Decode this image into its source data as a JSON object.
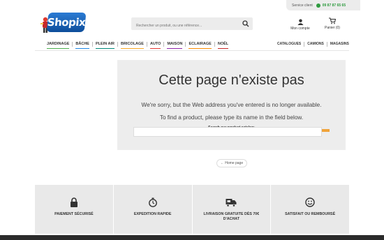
{
  "topbar": {
    "service_label": "Service client",
    "phone": "09 87 87 65 65"
  },
  "brand": {
    "logo_text": "Shopix",
    "primary_color": "#1a5fb4",
    "accent_color": "#f0a33a"
  },
  "search": {
    "placeholder": "Rechercher un produit, ou une référence..."
  },
  "account": {
    "label": "Mon compte"
  },
  "cart": {
    "label": "Panier (0)"
  },
  "nav": {
    "items": [
      {
        "label": "JARDINAGE",
        "color": "#4caf50"
      },
      {
        "label": "BÂCHE",
        "color": "#1e88e5"
      },
      {
        "label": "PLEIN AIR",
        "color": "#00897b"
      },
      {
        "label": "BRICOLAGE",
        "color": "#f9a825"
      },
      {
        "label": "AUTO",
        "color": "#e53935"
      },
      {
        "label": "MAISON",
        "color": "#8e24aa"
      },
      {
        "label": "ECLAIRAGE",
        "color": "#fb8c00"
      },
      {
        "label": "NOËL",
        "color": "#c62828"
      }
    ],
    "secondary": [
      {
        "label": "CATALOGUES"
      },
      {
        "label": "CAMIONS"
      },
      {
        "label": "MAGASINS"
      }
    ]
  },
  "error": {
    "title": "Cette page n'existe pas",
    "message1": "We're sorry, but the Web address you've entered is no longer available.",
    "message2": "To find a product, please type its name in the field below.",
    "catalog_label": "Search our product catalog:"
  },
  "home_button": "← Home page",
  "features": [
    {
      "label": "PAIEMENT SÉCURISÉ",
      "icon": "lock-icon"
    },
    {
      "label": "EXPEDITION RAPIDE",
      "icon": "stopwatch-icon"
    },
    {
      "label": "LIVRAISON GRATUITE DÈS 70€ D'ACHAT",
      "icon": "truck-icon"
    },
    {
      "label": "SATISFAIT OU REMBOURSÉ",
      "icon": "smiley-icon"
    }
  ]
}
